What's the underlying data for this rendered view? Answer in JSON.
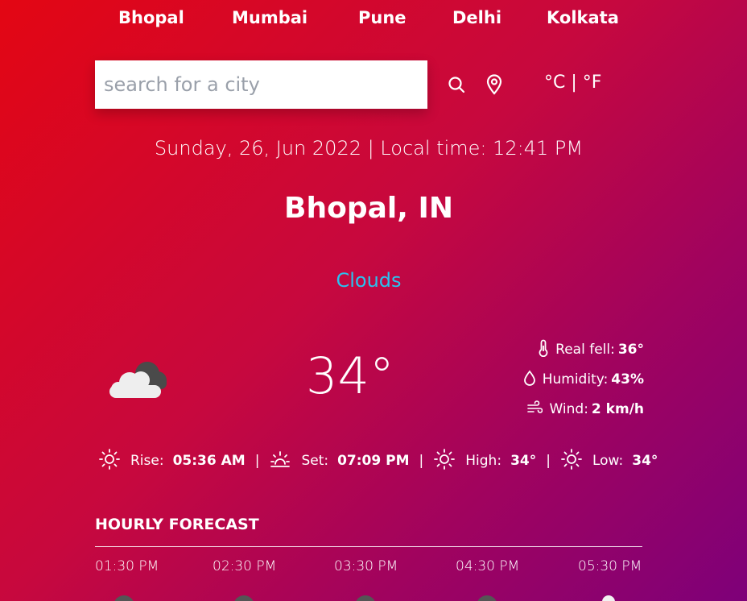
{
  "nav": {
    "cities": [
      "Bhopal",
      "Mumbai",
      "Pune",
      "Delhi",
      "Kolkata"
    ]
  },
  "search": {
    "placeholder": "search for a city",
    "value": ""
  },
  "icons": {
    "search": "search-icon",
    "location": "location-pin-icon",
    "weather": "clouds-icon",
    "thermometer": "thermometer-icon",
    "humidity": "droplet-icon",
    "wind": "wind-icon",
    "sunrise": "sun-icon",
    "sunset": "sunset-icon",
    "high": "sun-icon",
    "low": "sun-icon"
  },
  "units": {
    "celsius": "°C",
    "separator": "|",
    "fahrenheit": "°F"
  },
  "datetime": "Sunday, 26, Jun 2022 | Local time: 12:41 PM",
  "location": "Bhopal, IN",
  "condition": "Clouds",
  "temperature": "34°",
  "details": {
    "real_feel_label": "Real fell:",
    "real_feel_value": "36°",
    "humidity_label": "Humidity:",
    "humidity_value": "43%",
    "wind_label": "Wind:",
    "wind_value": "2 km/h"
  },
  "sun": {
    "rise_label": "Rise:",
    "rise_value": "05:36 AM",
    "set_label": "Set:",
    "set_value": "07:09 PM",
    "high_label": "High:",
    "high_value": "34°",
    "low_label": "Low:",
    "low_value": "34°",
    "separator": "|"
  },
  "hourly": {
    "title": "HOURLY FORECAST",
    "times": [
      "01:30 PM",
      "02:30 PM",
      "03:30 PM",
      "04:30 PM",
      "05:30 PM"
    ]
  },
  "colors": {
    "gradient_start": "#e30613",
    "gradient_end": "#7e0079",
    "condition_text": "#29c3f0"
  }
}
